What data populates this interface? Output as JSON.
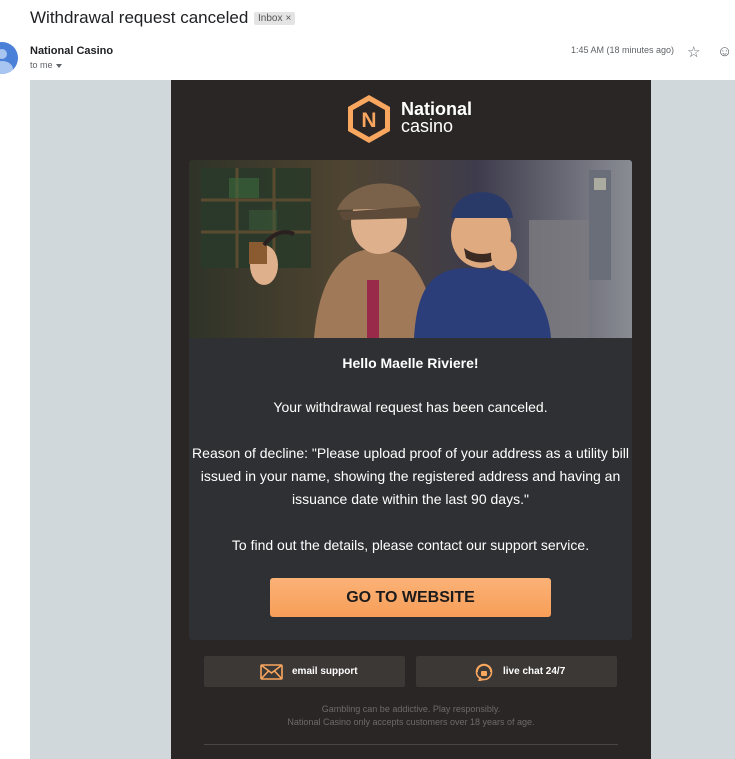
{
  "email": {
    "subject": "Withdrawal request canceled",
    "label": "Inbox",
    "label_remove": "×",
    "sender": "National Casino",
    "recipient": "to me",
    "time": "1:45 AM (18 minutes ago)"
  },
  "icons": {
    "star": "☆",
    "emoji": "☺"
  },
  "brand": {
    "logo_letter": "N",
    "name_line1": "National",
    "name_line2": "casino",
    "accent": "#f9a65f",
    "background": "#2a2626"
  },
  "body": {
    "greeting": "Hello Maelle Riviere!",
    "message": "Your withdrawal request has been canceled.",
    "reason_lines": [
      "Reason of decline: \"Please upload proof of your address as a utility bill",
      "issued in your name, showing the registered address and having an",
      "issuance date within the last 90 days.\""
    ],
    "support_note": "To find out the details, please contact our support service.",
    "cta": "GO TO WEBSITE"
  },
  "footer": {
    "email_support": "email support",
    "live_chat": "live chat 24/7",
    "disclaimer_1": "Gambling can be addictive. Play responsibly.",
    "disclaimer_2": "National Casino only accepts customers over 18 years of age."
  }
}
